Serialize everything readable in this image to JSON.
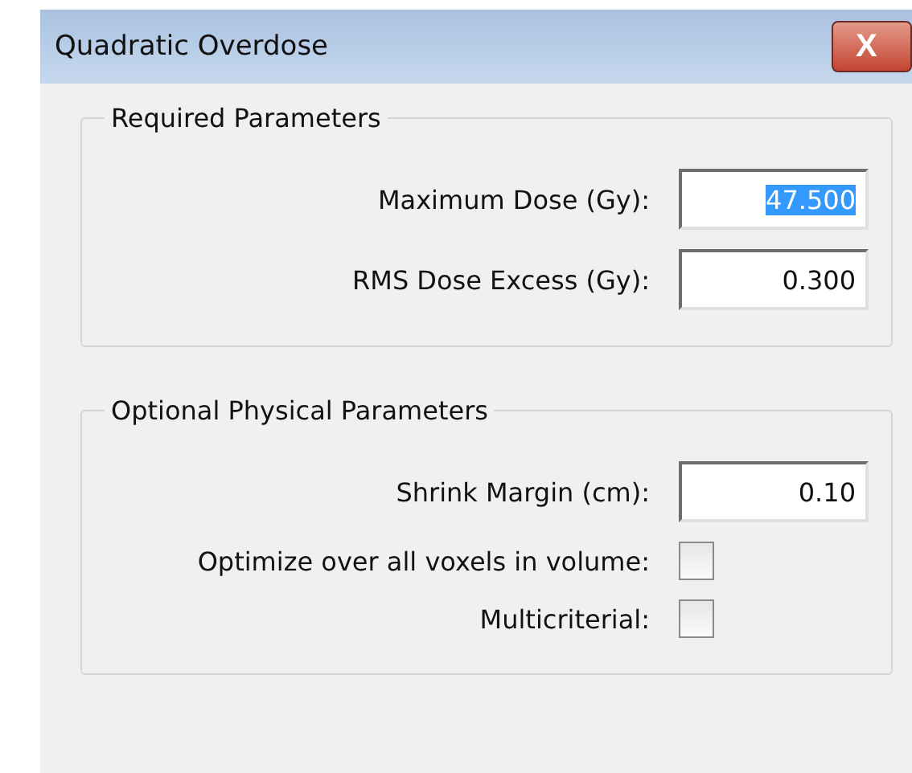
{
  "window": {
    "title": "Quadratic Overdose",
    "close": "X"
  },
  "groups": [
    {
      "title": "Required Parameters",
      "rows": [
        {
          "kind": "field",
          "label": "Maximum Dose (Gy):",
          "value": "47.500",
          "highlighted": true
        },
        {
          "kind": "field",
          "label": "RMS Dose Excess (Gy):",
          "value": "0.300",
          "highlighted": false
        }
      ]
    },
    {
      "title": "Optional Physical Parameters",
      "rows": [
        {
          "kind": "field",
          "label": "Shrink Margin (cm):",
          "value": "0.10",
          "highlighted": false
        },
        {
          "kind": "checkbox",
          "label": "Optimize over all voxels in volume:",
          "checked": false
        },
        {
          "kind": "checkbox",
          "label": "Multicriterial:",
          "checked": false
        }
      ]
    }
  ]
}
